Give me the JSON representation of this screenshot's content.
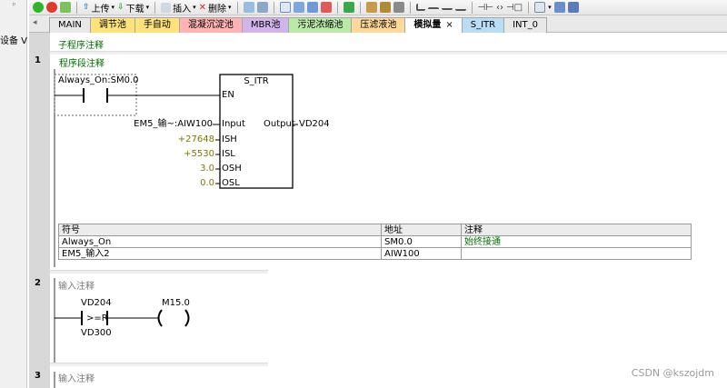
{
  "left_panel": {
    "label": "设备 V"
  },
  "toolbar": {
    "upload_label": "上传",
    "download_label": "下载",
    "insert_label": "插入",
    "delete_label": "删除"
  },
  "tabs": [
    {
      "label": "MAIN",
      "color": "#e8e8e8"
    },
    {
      "label": "调节池",
      "color": "#ffe27a"
    },
    {
      "label": "手自动",
      "color": "#ffe27a"
    },
    {
      "label": "混凝沉淀池",
      "color": "#ffb3b3"
    },
    {
      "label": "MBR池",
      "color": "#d2b4ec"
    },
    {
      "label": "污泥浓缩池",
      "color": "#b9eaa8"
    },
    {
      "label": "压滤液池",
      "color": "#ffd89a"
    },
    {
      "label": "模拟量",
      "color": "#ffffff"
    },
    {
      "label": "S_ITR",
      "color": "#b8ddf5"
    },
    {
      "label": "INT_0",
      "color": "#e8e8e8"
    }
  ],
  "editor": {
    "subroutine_comment": "子程序注释",
    "network1": {
      "number": "1",
      "comment": "程序段注释",
      "contact_label": "Always_On:SM0.0",
      "box_title": "S_ITR",
      "en": "EN",
      "inputs": [
        {
          "value": "EM5_输~:AIW100",
          "pin": "Input"
        },
        {
          "value": "+27648",
          "pin": "ISH"
        },
        {
          "value": "+5530",
          "pin": "ISL"
        },
        {
          "value": "3.0",
          "pin": "OSH"
        },
        {
          "value": "0.0",
          "pin": "OSL"
        }
      ],
      "output_pin": "Output",
      "output_value": "VD204",
      "symbol_table": {
        "headers": [
          "符号",
          "地址",
          "注释"
        ],
        "rows": [
          {
            "symbol": "Always_On",
            "address": "SM0.0",
            "comment": "始终接通"
          },
          {
            "symbol": "EM5_输入2",
            "address": "AIW100",
            "comment": ""
          }
        ]
      }
    },
    "network2": {
      "number": "2",
      "comment": "输入注释",
      "compare_top": "VD204",
      "compare_op": ">=R",
      "compare_bottom": "VD300",
      "coil_label": "M15.0"
    },
    "network3": {
      "number": "3",
      "comment": "输入注释"
    }
  },
  "watermark": "CSDN @kszojdm"
}
